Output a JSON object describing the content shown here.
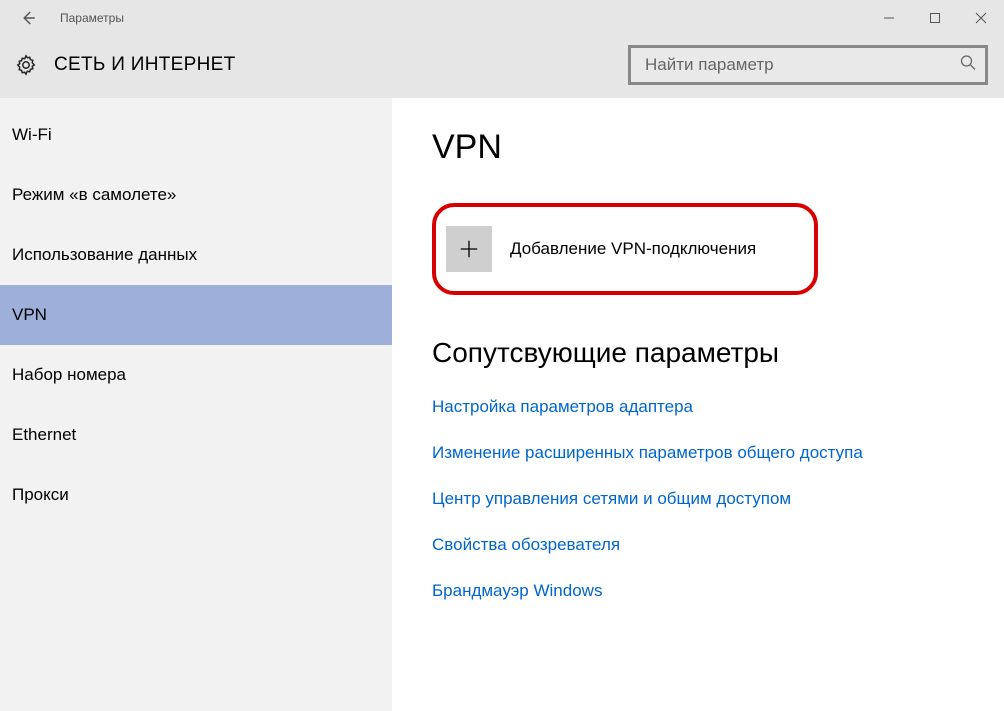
{
  "window": {
    "title": "Параметры"
  },
  "header": {
    "section_title": "СЕТЬ И ИНТЕРНЕТ",
    "search_placeholder": "Найти параметр"
  },
  "sidebar": {
    "items": [
      {
        "label": "Wi-Fi",
        "selected": false
      },
      {
        "label": "Режим «в самолете»",
        "selected": false
      },
      {
        "label": "Использование данных",
        "selected": false
      },
      {
        "label": "VPN",
        "selected": true
      },
      {
        "label": "Набор номера",
        "selected": false
      },
      {
        "label": "Ethernet",
        "selected": false
      },
      {
        "label": "Прокси",
        "selected": false
      }
    ]
  },
  "main": {
    "page_title": "VPN",
    "add_vpn_label": "Добавление VPN-подключения",
    "related_heading": "Сопутсвующие параметры",
    "links": [
      "Настройка параметров адаптера",
      "Изменение расширенных параметров общего доступа",
      "Центр управления сетями и общим доступом",
      "Свойства обозревателя",
      "Брандмауэр Windows"
    ]
  }
}
